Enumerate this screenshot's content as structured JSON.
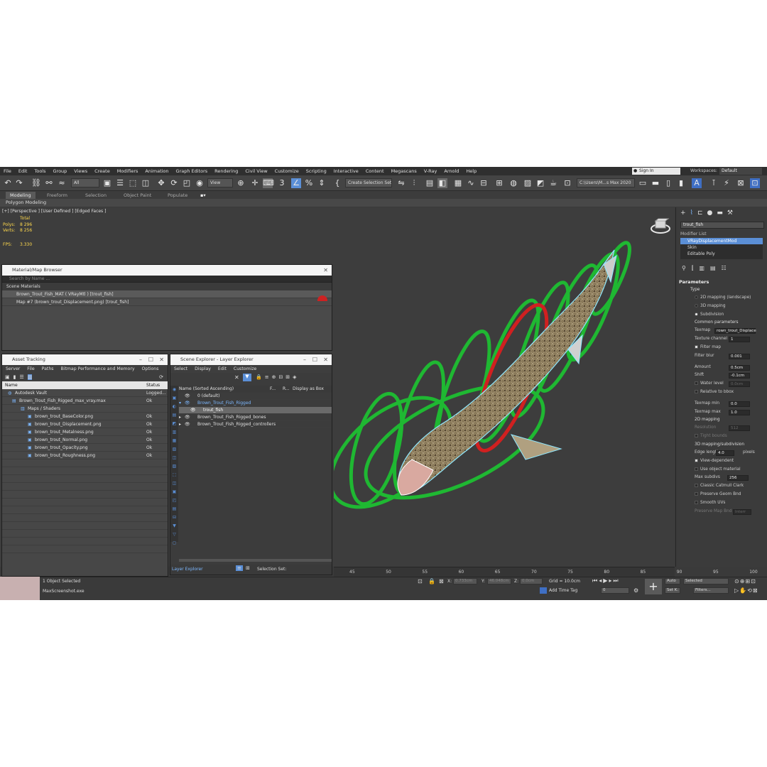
{
  "menu": [
    "File",
    "Edit",
    "Tools",
    "Group",
    "Views",
    "Create",
    "Modifiers",
    "Animation",
    "Graph Editors",
    "Rendering",
    "Civil View",
    "Customize",
    "Scripting",
    "Interactive",
    "Content",
    "Megascans",
    "V-Ray",
    "Arnold",
    "Help"
  ],
  "signin": "Sign In",
  "workspaces": {
    "label": "Workspaces:",
    "value": "Default"
  },
  "toolbar": {
    "filter": "All",
    "refcoord": "View",
    "selection_set": "Create Selection Set",
    "project_path": "C:\\Users\\M...s Max 2020"
  },
  "ribbon": {
    "tabs": [
      "Modeling",
      "Freeform",
      "Selection",
      "Object Paint",
      "Populate"
    ],
    "sub": "Polygon Modeling"
  },
  "viewport": {
    "label": "[+] [Perspective ] [User Defined ] [Edged Faces ]",
    "stats_title": "Total",
    "polys_label": "Polys:",
    "polys": "8 296",
    "verts_label": "Verts:",
    "verts": "8 256",
    "fps_label": "FPS:",
    "fps": "3.330"
  },
  "material_browser": {
    "title": "Material/Map Browser",
    "search": "Search by Name ...",
    "section": "Scene Materials",
    "items": [
      "Brown_Trout_Fish_MAT  ( VRayMtl ) [trout_fish]",
      "Map #7 (brown_trout_Displacement.png) [trout_fish]"
    ]
  },
  "asset_tracking": {
    "title": "Asset Tracking",
    "menu": [
      "Server",
      "File",
      "Paths",
      "Bitmap Performance and Memory",
      "Options"
    ],
    "col_name": "Name",
    "col_status": "Status",
    "rows": [
      {
        "name": "Autodesk Vault",
        "status": "Logged..."
      },
      {
        "name": "Brown_Trout_Fish_Rigged_max_vray.max",
        "status": "Ok"
      },
      {
        "name": "Maps / Shaders",
        "status": ""
      },
      {
        "name": "brown_trout_BaseColor.png",
        "status": "Ok"
      },
      {
        "name": "brown_trout_Displacement.png",
        "status": "Ok"
      },
      {
        "name": "brown_trout_Metalness.png",
        "status": "Ok"
      },
      {
        "name": "brown_trout_Normal.png",
        "status": "Ok"
      },
      {
        "name": "brown_trout_Opacity.png",
        "status": "Ok"
      },
      {
        "name": "brown_trout_Roughness.png",
        "status": "Ok"
      }
    ]
  },
  "scene_explorer": {
    "title": "Scene Explorer - Layer Explorer",
    "menu": [
      "Select",
      "Display",
      "Edit",
      "Customize"
    ],
    "col_name": "Name (Sorted Ascending)",
    "col_f": "F...",
    "col_r": "R...",
    "col_display": "Display as Box",
    "rows": [
      "0 (default)",
      "Brown_Trout_Fish_Rigged",
      "trout_fish",
      "Brown_Trout_Fish_Rigged_bones",
      "Brown_Trout_Fish_Rigged_controllers"
    ],
    "footer_left": "Layer Explorer",
    "footer_right": "Selection Set:"
  },
  "command_panel": {
    "object_name": "trout_fish",
    "modifier_list_label": "Modifier List",
    "modifiers": [
      "VRayDisplacementMod",
      "Skin",
      "Editable Poly"
    ],
    "parameters": "Parameters",
    "type_label": "Type",
    "type_options": [
      "2D mapping (landscape)",
      "3D mapping",
      "Subdivision"
    ],
    "common": "Common parameters",
    "texmap_label": "Texmap",
    "texmap_value": "rown_trout_Displace",
    "tex_channel_label": "Texture channel",
    "tex_channel": "1",
    "filter_map": "Filter map",
    "filter_blur_label": "Filter blur",
    "filter_blur": "0.001",
    "amount_label": "Amount",
    "amount": "0.5cm",
    "shift_label": "Shift",
    "shift": "-0.1cm",
    "water_level_label": "Water level",
    "water_level": "0.0cm",
    "relative_bbox": "Relative to bbox",
    "texmap_min_label": "Texmap min",
    "texmap_min": "0.0",
    "texmap_max_label": "Texmap max",
    "texmap_max": "1.0",
    "mapping2d": "2D mapping",
    "resolution_label": "Resolution",
    "resolution": "512",
    "tight_bounds": "Tight bounds",
    "mapping3d": "3D mapping/subdivision",
    "edge_length_label": "Edge length",
    "edge_length": "4.0",
    "edge_unit": "pixels",
    "view_dependent": "View-dependent",
    "use_object_material": "Use object material",
    "max_subdivs_label": "Max subdivs",
    "max_subdivs": "256",
    "classic_cc": "Classic Catmull Clark",
    "preserve_geom": "Preserve Geom Bnd",
    "smooth_uvs": "Smooth UVs",
    "preserve_map_bnd": "Preserve Map Bnd",
    "preserve_map_val": "Interr"
  },
  "timeline": {
    "ticks": [
      "45",
      "50",
      "55",
      "60",
      "65",
      "70",
      "75",
      "80",
      "85",
      "90",
      "95",
      "100"
    ]
  },
  "status": {
    "selected": "1 Object Selected",
    "app": "MaxScreenshot.exe",
    "x_label": "X:",
    "x": "0.733cm",
    "y_label": "Y:",
    "y": "46.048cm",
    "z_label": "Z:",
    "z": "0.0cm",
    "grid": "Grid = 10.0cm",
    "add_time_tag": "Add Time Tag",
    "frame": "0",
    "auto": "Auto",
    "selected_drop": "Selected",
    "setk": "Set K.",
    "filters": "Filters..."
  },
  "colors": {
    "accent": "#5b8fd6",
    "controller_green": "#1fb832",
    "controller_red": "#d02020",
    "wire_cyan": "#8fe8ff"
  }
}
